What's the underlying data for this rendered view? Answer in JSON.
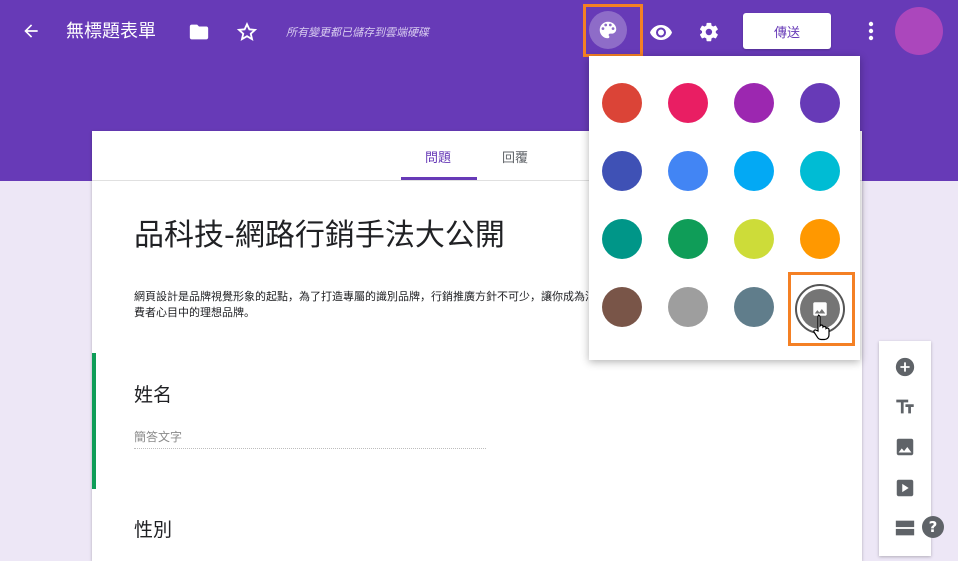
{
  "header": {
    "title": "無標題表單",
    "saved_status": "所有變更都已儲存到雲端硬碟",
    "send_label": "傳送",
    "icons": [
      "back-arrow-icon",
      "folder-icon",
      "star-icon",
      "palette-icon",
      "eye-icon",
      "gear-icon",
      "more-vert-icon"
    ]
  },
  "tabs": [
    {
      "label": "問題",
      "active": true
    },
    {
      "label": "回覆",
      "active": false
    }
  ],
  "form": {
    "title": "品科技-網路行銷手法大公開",
    "description": "網頁設計是品牌視覺形象的起點，為了打造專屬的識別品牌，行銷推廣方針不可少，讓你成為消費者心目中的理想品牌。",
    "questions": [
      {
        "title": "姓名",
        "placeholder": "簡答文字"
      },
      {
        "title": "性別"
      }
    ]
  },
  "palette": {
    "colors": [
      "#db4437",
      "#e91e63",
      "#9c27b0",
      "#673ab7",
      "#3f51b5",
      "#4285f4",
      "#03a9f4",
      "#00bcd4",
      "#009688",
      "#0f9d58",
      "#cddc39",
      "#ff9800",
      "#795548",
      "#9e9e9e",
      "#607d8b"
    ],
    "image_option_icon": "image-icon"
  },
  "side_tools": [
    "add-circle-icon",
    "title-text-icon",
    "image-icon",
    "video-icon",
    "section-icon"
  ],
  "help_label": "?"
}
